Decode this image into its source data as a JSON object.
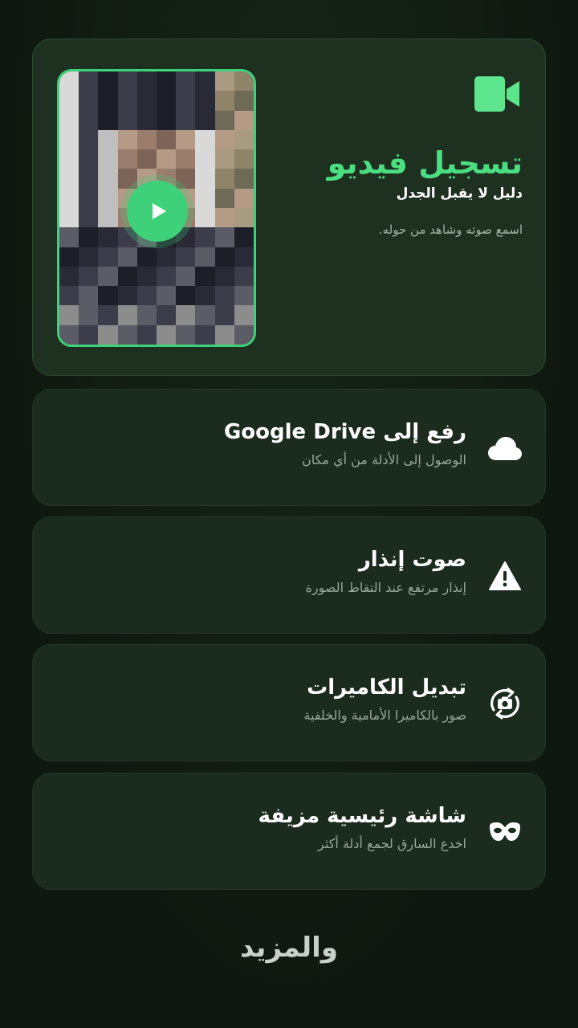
{
  "hero": {
    "title": "تسجيل فيديو",
    "subtitle": "دليل لا يقبل الجدل",
    "description": "اسمع صوته وشاهد من حوله.",
    "icon": "video-camera-icon",
    "play_icon": "play-icon",
    "accent": "#3fd17a"
  },
  "features": [
    {
      "title": "رفع إلى Google Drive",
      "subtitle": "الوصول إلى الأدلة من أي مكان",
      "icon": "cloud-icon"
    },
    {
      "title": "صوت إنذار",
      "subtitle": "إنذار مرتفع عند التقاط الصورة",
      "icon": "warning-icon"
    },
    {
      "title": "تبديل الكاميرات",
      "subtitle": "صور بالكاميرا الأمامية والخلفية",
      "icon": "switch-camera-icon"
    },
    {
      "title": "شاشة رئيسية مزيفة",
      "subtitle": "اخدع السارق لجمع أدلة أكثر",
      "icon": "mask-icon"
    }
  ],
  "more_label": "والمزيد"
}
